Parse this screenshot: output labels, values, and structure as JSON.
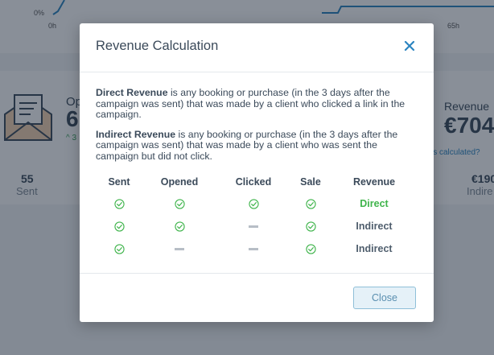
{
  "background": {
    "chart": {
      "y_tick": "0%",
      "x_tick_start": "0h",
      "x_tick_end": "65h"
    },
    "opened": {
      "label": "Op",
      "value": "6",
      "trend": "^ 3"
    },
    "revenue": {
      "label": "Revenue",
      "value": "€704",
      "link": "is calculated?"
    },
    "sent": {
      "value": "55",
      "label": "Sent"
    },
    "indirect": {
      "value": "€190",
      "label": "Indire"
    }
  },
  "modal": {
    "title": "Revenue Calculation",
    "direct_term": "Direct Revenue",
    "direct_text": " is any booking or purchase (in the 3 days after the campaign was sent) that was made by a client who clicked a link in the campaign.",
    "indirect_term": "Indirect Revenue",
    "indirect_text": " is any booking or purchase (in the 3 days after the campaign was sent) that was made by a client who was sent the campaign but did not click.",
    "table": {
      "headers": [
        "Sent",
        "Opened",
        "Clicked",
        "Sale",
        "Revenue"
      ],
      "rows": [
        {
          "sent": "check",
          "opened": "check",
          "clicked": "check",
          "sale": "check",
          "revenue": "Direct"
        },
        {
          "sent": "check",
          "opened": "check",
          "clicked": "dash",
          "sale": "check",
          "revenue": "Indirect"
        },
        {
          "sent": "check",
          "opened": "dash",
          "clicked": "dash",
          "sale": "check",
          "revenue": "Indirect"
        }
      ]
    },
    "close_button": "Close"
  },
  "icons": {
    "check": "check-circle-icon",
    "dash": "dash-icon",
    "close": "close-icon",
    "envelope": "envelope-icon"
  },
  "colors": {
    "accent": "#2b84c0",
    "check_green": "#3fb44b",
    "dash_grey": "#b7bec6"
  }
}
